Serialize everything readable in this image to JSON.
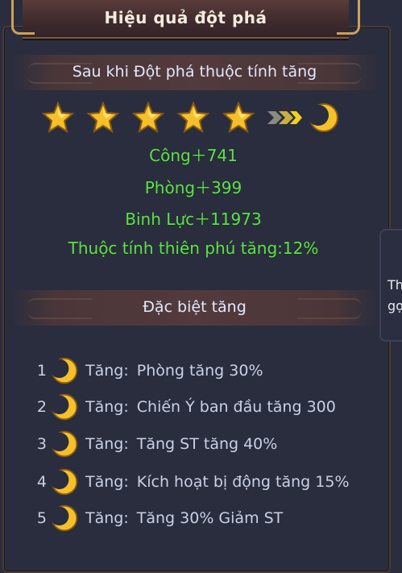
{
  "title": "Hiệu quả đột phá",
  "section1": "Sau khi Đột phá thuộc tính tăng",
  "stars": {
    "count": 5,
    "result_icon": "moon-icon"
  },
  "stats": [
    "Công＋741",
    "Phòng＋399",
    "Binh Lực＋11973",
    "Thuộc tính thiên phú tăng:12%"
  ],
  "section2": "Đặc biệt tăng",
  "special": [
    {
      "num": "1",
      "label": "Tăng:",
      "desc": "Phòng tăng 30%"
    },
    {
      "num": "2",
      "label": "Tăng:",
      "desc": "Chiến Ý ban đầu tăng 300"
    },
    {
      "num": "3",
      "label": "Tăng:",
      "desc": "Tăng ST tăng 40%"
    },
    {
      "num": "4",
      "label": "Tăng:",
      "desc": "Kích hoạt bị động tăng 15%"
    },
    {
      "num": "5",
      "label": "Tăng:",
      "desc": "Tăng 30% Giảm ST"
    }
  ],
  "side_tab": {
    "line1": "Thi",
    "line2": "gọi"
  },
  "colors": {
    "stat_green": "#5ee04a",
    "gold": "#f5c02a",
    "panel": "#2a2d3e"
  }
}
